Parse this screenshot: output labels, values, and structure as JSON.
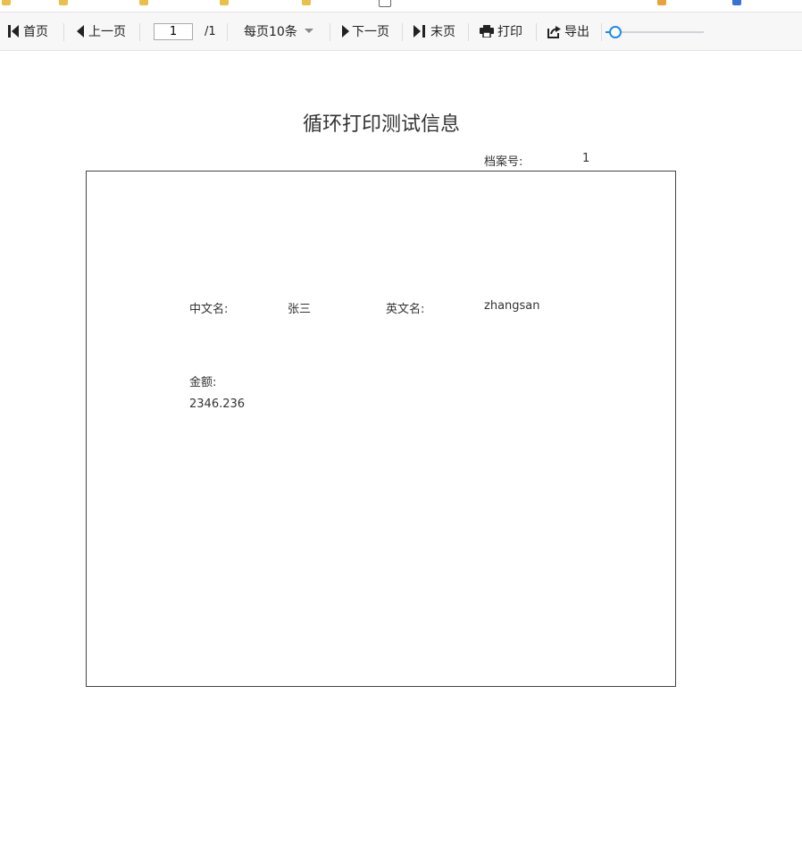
{
  "colors": {
    "accent": "#1e8bea",
    "toolbar_bg": "#f7f7f8",
    "border": "#444444"
  },
  "toolbar": {
    "first_label": "首页",
    "prev_label": "上一页",
    "page_current": "1",
    "page_total": "/1",
    "page_size_label": "每页10条",
    "next_label": "下一页",
    "last_label": "末页",
    "print_label": "打印",
    "export_label": "导出",
    "zoom_fraction": 0.1,
    "icons": {
      "first": "skip-first-icon",
      "prev": "triangle-left-icon",
      "page_size": "caret-down-icon",
      "next": "triangle-right-icon",
      "last": "skip-last-icon",
      "print": "printer-icon",
      "export": "export-icon"
    }
  },
  "report": {
    "title": "循环打印测试信息",
    "archive_label": "档案号:",
    "archive_value": "1",
    "chinese_name_label": "中文名:",
    "chinese_name_value": "张三",
    "english_name_label": "英文名:",
    "english_name_value": "zhangsan",
    "amount_label": "金额:",
    "amount_value": "2346.236"
  }
}
